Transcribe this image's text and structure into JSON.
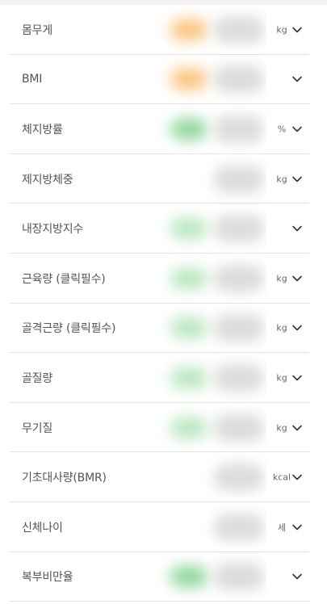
{
  "rows": [
    {
      "label": "몸무게",
      "unit": "kg",
      "tint": "#f9c37c"
    },
    {
      "label": "BMI",
      "unit": "",
      "tint": "#f9c37c"
    },
    {
      "label": "체지방률",
      "unit": "%",
      "tint": "#8fd59b"
    },
    {
      "label": "제지방체중",
      "unit": "kg",
      "tint": ""
    },
    {
      "label": "내장지방지수",
      "unit": "",
      "tint": "#b8e6bf"
    },
    {
      "label": "근육량 (클릭필수)",
      "unit": "kg",
      "tint": "#b8e6bf"
    },
    {
      "label": "골격근량 (클릭필수)",
      "unit": "kg",
      "tint": "#b8e6bf"
    },
    {
      "label": "골질량",
      "unit": "kg",
      "tint": "#b8e6bf"
    },
    {
      "label": "무기질",
      "unit": "kg",
      "tint": "#b8e6bf"
    },
    {
      "label": "기초대사량(BMR)",
      "unit": "kcal",
      "tint": ""
    },
    {
      "label": "신체나이",
      "unit": "세",
      "tint": ""
    },
    {
      "label": "복부비만율",
      "unit": "",
      "tint": "#8fd59b"
    }
  ],
  "icons": {
    "expand": "chevron-down-icon"
  }
}
